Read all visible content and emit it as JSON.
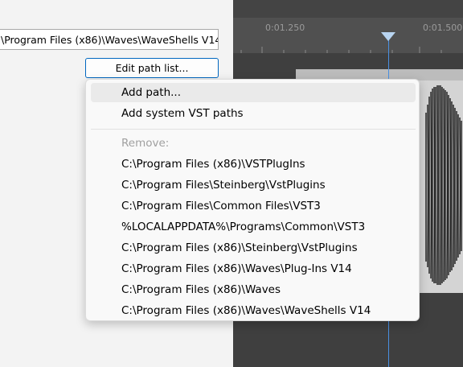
{
  "settings": {
    "vst_path_value": "\\Program Files (x86)\\Waves\\WaveShells V14",
    "edit_button_label": "Edit path list..."
  },
  "timeline": {
    "ruler_labels": [
      "0:01.250",
      "0:01.500"
    ]
  },
  "menu": {
    "add_path": "Add path...",
    "add_system": "Add system VST paths",
    "remove_header": "Remove:",
    "remove_items": [
      "C:\\Program Files (x86)\\VSTPlugIns",
      "C:\\Program Files\\Steinberg\\VstPlugins",
      "C:\\Program Files\\Common Files\\VST3",
      "%LOCALAPPDATA%\\Programs\\Common\\VST3",
      "C:\\Program Files (x86)\\Steinberg\\VstPlugins",
      "C:\\Program Files (x86)\\Waves\\Plug-Ins V14",
      "C:\\Program Files (x86)\\Waves",
      "C:\\Program Files (x86)\\Waves\\WaveShells V14"
    ]
  },
  "colors": {
    "accent": "#0067c0",
    "playhead": "#4a90e2"
  }
}
